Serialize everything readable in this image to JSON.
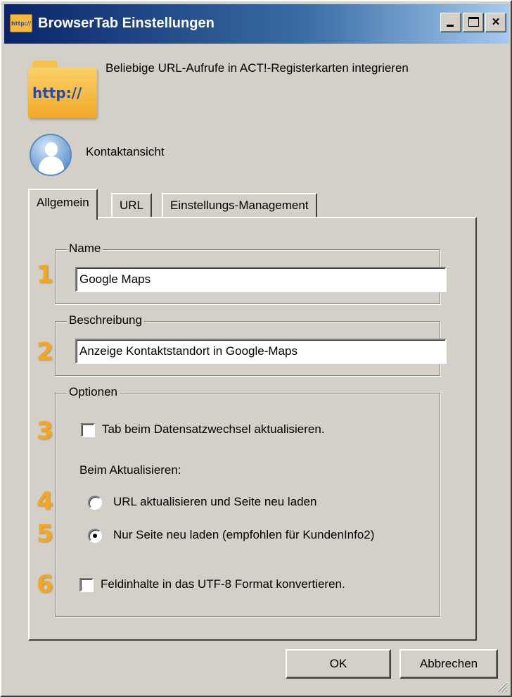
{
  "window": {
    "title": "BrowserTab Einstellungen",
    "title_icon_text": "http://",
    "minimize_label": "minimize",
    "maximize_label": "maximize",
    "close_label": "×"
  },
  "header": {
    "icon_text": "http://",
    "description": "Beliebige URL-Aufrufe in ACT!-Registerkarten integrieren"
  },
  "view": {
    "label": "Kontaktansicht"
  },
  "tabs": [
    {
      "label": "Allgemein",
      "active": true
    },
    {
      "label": "URL",
      "active": false
    },
    {
      "label": "Einstellungs-Management",
      "active": false
    }
  ],
  "general": {
    "name_group": {
      "legend": "Name",
      "value": "Google Maps",
      "marker": "1"
    },
    "description_group": {
      "legend": "Beschreibung",
      "value": "Anzeige Kontaktstandort in Google-Maps",
      "marker": "2"
    },
    "options_group": {
      "legend": "Optionen",
      "refresh_tab_label": "Tab beim Datensatzwechsel aktualisieren.",
      "refresh_tab_checked": false,
      "refresh_tab_marker": "3",
      "on_refresh_label": "Beim Aktualisieren:",
      "radio_url_label": "URL aktualisieren und Seite neu laden",
      "radio_url_selected": false,
      "radio_url_marker": "4",
      "radio_reload_label": "Nur Seite neu laden (empfohlen für KundenInfo2)",
      "radio_reload_selected": true,
      "radio_reload_marker": "5",
      "utf8_label": "Feldinhalte in das UTF-8 Format konvertieren.",
      "utf8_checked": false,
      "utf8_marker": "6"
    }
  },
  "buttons": {
    "ok": "OK",
    "cancel": "Abbrechen"
  },
  "colors": {
    "marker": "#f5a623",
    "titlebar": "#0a246a",
    "face": "#d4d0c8"
  }
}
